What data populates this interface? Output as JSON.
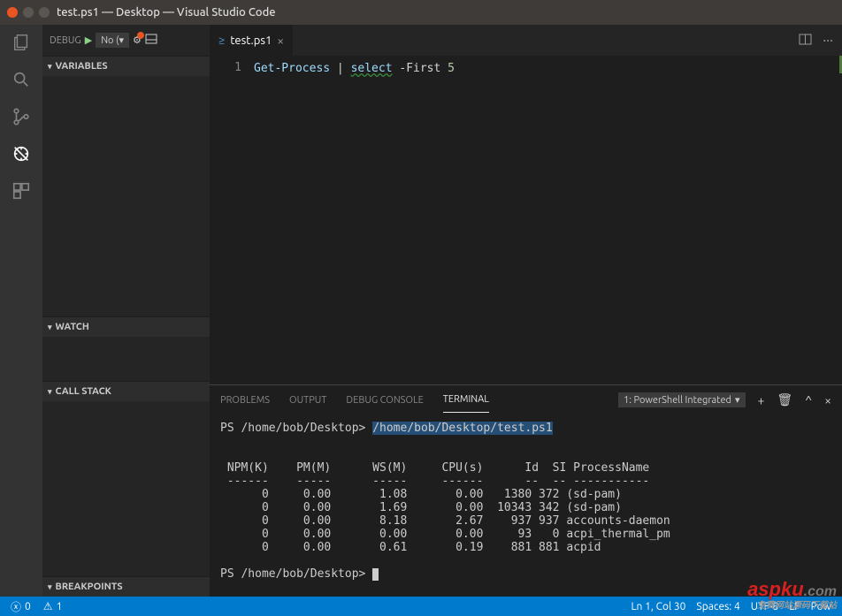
{
  "window": {
    "title": "test.ps1 — Desktop — Visual Studio Code"
  },
  "debug_bar": {
    "label": "DEBUG",
    "config": "No (▾"
  },
  "sidebar_panels": {
    "variables": "VARIABLES",
    "watch": "WATCH",
    "callstack": "CALL STACK",
    "breakpoints": "BREAKPOINTS"
  },
  "tab": {
    "name": "test.ps1"
  },
  "editor": {
    "line_no": "1",
    "tok_cmd": "Get-Process",
    "tok_pipe": " | ",
    "tok_sel": "select",
    "tok_param": " -First ",
    "tok_num": "5"
  },
  "terminal": {
    "tabs": {
      "problems": "PROBLEMS",
      "output": "OUTPUT",
      "debug": "DEBUG CONSOLE",
      "terminal": "TERMINAL"
    },
    "selector": "1: PowerShell Integrated",
    "prompt1": "PS /home/bob/Desktop>",
    "cmd1": "/home/bob/Desktop/test.ps1",
    "header": " NPM(K)    PM(M)      WS(M)     CPU(s)      Id  SI ProcessName",
    "divider": " ------    -----      -----     ------      --  -- -----------",
    "rows": [
      "      0     0.00       1.08       0.00   1380 372 (sd-pam)",
      "      0     0.00       1.69       0.00  10343 342 (sd-pam)",
      "      0     0.00       8.18       2.67    937 937 accounts-daemon",
      "      0     0.00       0.00       0.00     93   0 acpi_thermal_pm",
      "      0     0.00       0.61       0.19    881 881 acpid"
    ],
    "prompt2": "PS /home/bob/Desktop>"
  },
  "statusbar": {
    "errors": "0",
    "warnings": "1",
    "ln_col": "Ln 1, Col 30",
    "spaces": "Spaces: 4",
    "encoding": "UTF-8",
    "eol": "LF",
    "lang": "Pow"
  },
  "watermark": {
    "brand": "aspku",
    "tld": ".com",
    "tagline": "免费网站源码下载站"
  }
}
